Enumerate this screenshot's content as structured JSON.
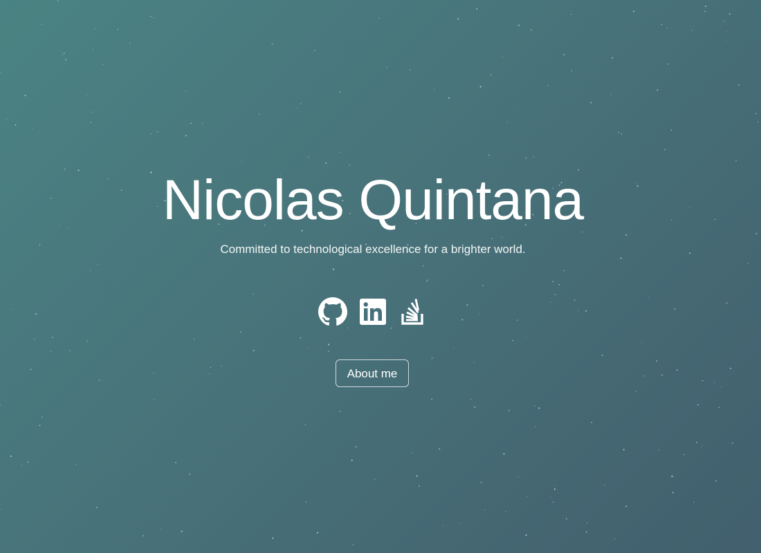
{
  "hero": {
    "name": "Nicolas Quintana",
    "tagline": "Committed to technological excellence for a brighter world."
  },
  "social": [
    {
      "icon": "github-icon",
      "label": "GitHub"
    },
    {
      "icon": "linkedin-icon",
      "label": "LinkedIn"
    },
    {
      "icon": "stackoverflow-icon",
      "label": "Stack Overflow"
    }
  ],
  "actions": {
    "about_label": "About me"
  },
  "colors": {
    "gradient_start": "#4a8383",
    "gradient_end": "#425f6d",
    "text": "#ffffff"
  }
}
